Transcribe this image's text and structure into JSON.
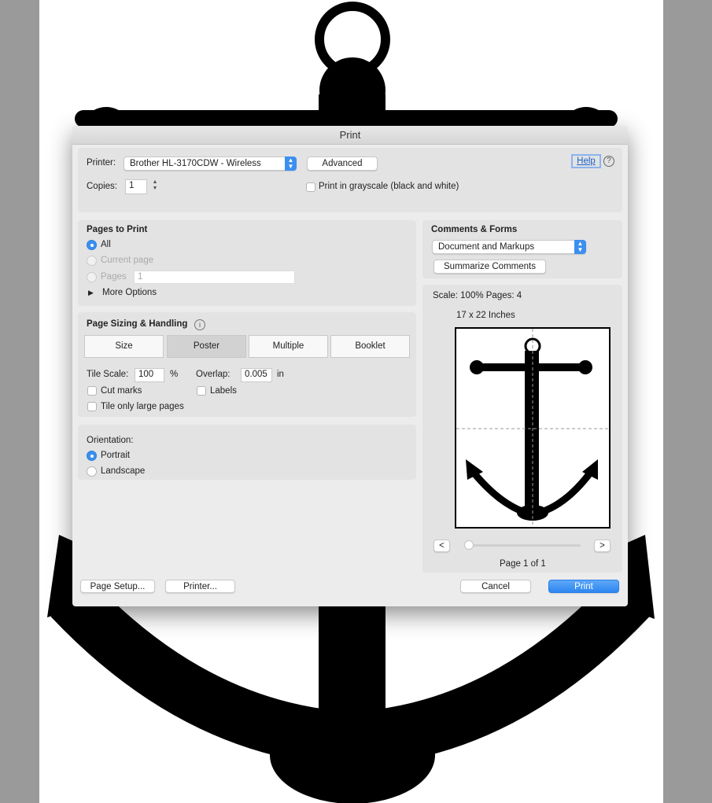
{
  "dialog": {
    "title": "Print"
  },
  "printer": {
    "label": "Printer:",
    "value": "Brother HL-3170CDW - Wireless",
    "advanced": "Advanced",
    "help": "Help",
    "help_icon": "question-circle-icon"
  },
  "copies": {
    "label": "Copies:",
    "value": "1"
  },
  "grayscale": {
    "label": "Print in grayscale (black and white)",
    "checked": false
  },
  "pages": {
    "title": "Pages to Print",
    "all": "All",
    "current": "Current page",
    "pages": "Pages",
    "pages_value": "1",
    "more": "More Options"
  },
  "sizing": {
    "title": "Page Sizing & Handling",
    "tabs": [
      "Size",
      "Poster",
      "Multiple",
      "Booklet"
    ],
    "selected": "Poster",
    "tile_scale_label": "Tile Scale:",
    "tile_scale": "100",
    "percent": "%",
    "overlap_label": "Overlap:",
    "overlap": "0.005",
    "overlap_unit": "in",
    "cut_marks": "Cut marks",
    "labels": "Labels",
    "tile_large": "Tile only large pages"
  },
  "orientation": {
    "title": "Orientation:",
    "portrait": "Portrait",
    "landscape": "Landscape",
    "selected": "Portrait"
  },
  "comments": {
    "title": "Comments & Forms",
    "value": "Document and Markups",
    "summarize": "Summarize Comments"
  },
  "preview": {
    "scale": "Scale: 100% Pages: 4",
    "size": "17 x 22 Inches",
    "prev": "<",
    "next": ">",
    "page": "Page 1 of 1",
    "slider_position": 0
  },
  "footer": {
    "page_setup": "Page Setup...",
    "printer": "Printer...",
    "cancel": "Cancel",
    "print": "Print"
  },
  "colors": {
    "accent": "#3b8ff0",
    "sidebar_gray": "#9a9a9a"
  }
}
